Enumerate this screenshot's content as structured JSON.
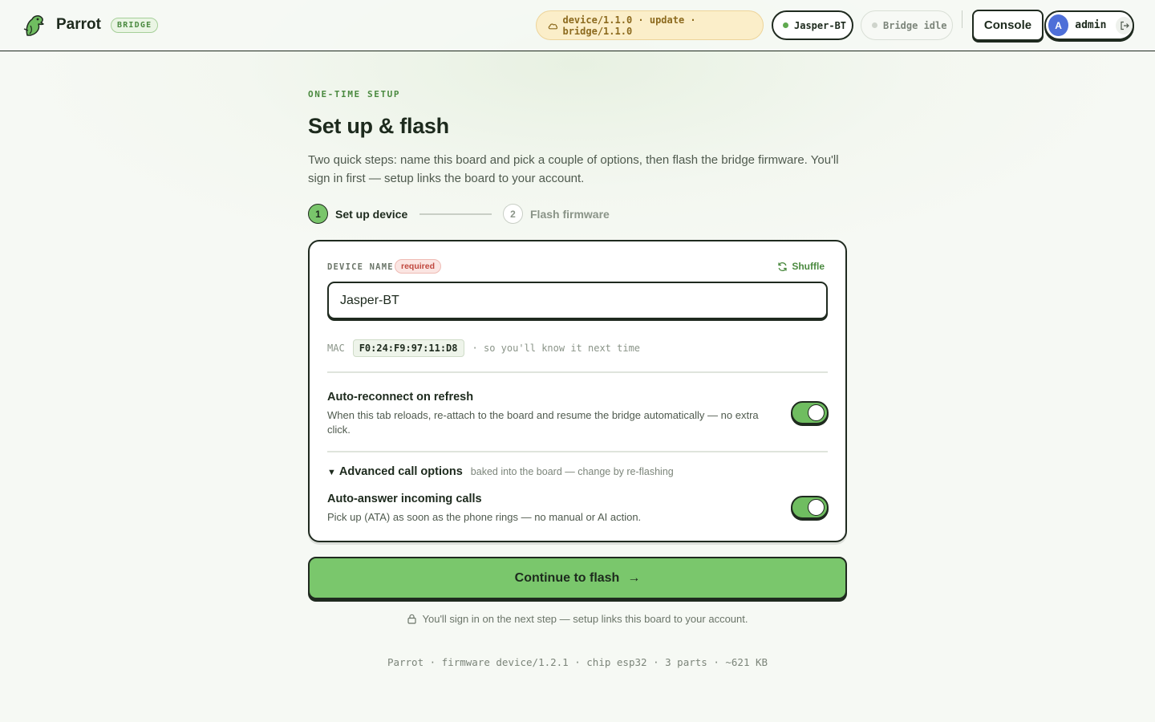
{
  "brand": {
    "name": "Parrot",
    "badge": "BRIDGE"
  },
  "header": {
    "update_pill": "device/1.1.0 · update · bridge/1.1.0",
    "device_pill": "Jasper-BT",
    "bridge_status": "Bridge idle",
    "console_label": "Console",
    "user": {
      "initial": "A",
      "name": "admin"
    }
  },
  "page": {
    "eyebrow": "ONE-TIME SETUP",
    "title": "Set up & flash",
    "subtitle": "Two quick steps: name this board and pick a couple of options, then flash the bridge firmware. You'll sign in first — setup links the board to your account."
  },
  "stepper": [
    {
      "num": "1",
      "label": "Set up device",
      "active": true
    },
    {
      "num": "2",
      "label": "Flash firmware",
      "active": false
    }
  ],
  "form": {
    "device_name_label": "DEVICE NAME",
    "required_badge": "required",
    "shuffle_label": "Shuffle",
    "device_name_value": "Jasper-BT",
    "mac_label": "MAC",
    "mac_value": "F0:24:F9:97:11:D8",
    "mac_note": "· so you'll know it next time",
    "auto_reconnect": {
      "title": "Auto-reconnect on refresh",
      "desc": "When this tab reloads, re-attach to the board and resume the bridge automatically — no extra click.",
      "enabled": true
    },
    "advanced": {
      "title": "Advanced call options",
      "note": "baked into the board — change by re-flashing"
    },
    "auto_answer": {
      "title": "Auto-answer incoming calls",
      "desc": "Pick up (ATA) as soon as the phone rings — no manual or AI action.",
      "enabled": true
    }
  },
  "cta": {
    "label": "Continue to flash",
    "arrow": "→"
  },
  "signin_note": "You'll sign in on the next step — setup links this board to your account.",
  "footer": "Parrot · firmware device/1.2.1 · chip esp32 · 3 parts · ~621 KB",
  "colors": {
    "accent": "#7ac76c",
    "ink": "#1f2a1f",
    "warning_bg": "#fbeec9",
    "avatar": "#4e6fd8"
  }
}
